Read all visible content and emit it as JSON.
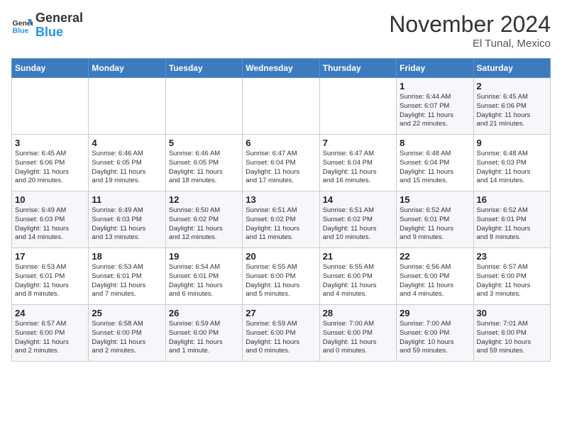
{
  "header": {
    "logo_general": "General",
    "logo_blue": "Blue",
    "month": "November 2024",
    "location": "El Tunal, Mexico"
  },
  "weekdays": [
    "Sunday",
    "Monday",
    "Tuesday",
    "Wednesday",
    "Thursday",
    "Friday",
    "Saturday"
  ],
  "weeks": [
    [
      {
        "day": "",
        "info": ""
      },
      {
        "day": "",
        "info": ""
      },
      {
        "day": "",
        "info": ""
      },
      {
        "day": "",
        "info": ""
      },
      {
        "day": "",
        "info": ""
      },
      {
        "day": "1",
        "info": "Sunrise: 6:44 AM\nSunset: 6:07 PM\nDaylight: 11 hours\nand 22 minutes."
      },
      {
        "day": "2",
        "info": "Sunrise: 6:45 AM\nSunset: 6:06 PM\nDaylight: 11 hours\nand 21 minutes."
      }
    ],
    [
      {
        "day": "3",
        "info": "Sunrise: 6:45 AM\nSunset: 6:06 PM\nDaylight: 11 hours\nand 20 minutes."
      },
      {
        "day": "4",
        "info": "Sunrise: 6:46 AM\nSunset: 6:05 PM\nDaylight: 11 hours\nand 19 minutes."
      },
      {
        "day": "5",
        "info": "Sunrise: 6:46 AM\nSunset: 6:05 PM\nDaylight: 11 hours\nand 18 minutes."
      },
      {
        "day": "6",
        "info": "Sunrise: 6:47 AM\nSunset: 6:04 PM\nDaylight: 11 hours\nand 17 minutes."
      },
      {
        "day": "7",
        "info": "Sunrise: 6:47 AM\nSunset: 6:04 PM\nDaylight: 11 hours\nand 16 minutes."
      },
      {
        "day": "8",
        "info": "Sunrise: 6:48 AM\nSunset: 6:04 PM\nDaylight: 11 hours\nand 15 minutes."
      },
      {
        "day": "9",
        "info": "Sunrise: 6:48 AM\nSunset: 6:03 PM\nDaylight: 11 hours\nand 14 minutes."
      }
    ],
    [
      {
        "day": "10",
        "info": "Sunrise: 6:49 AM\nSunset: 6:03 PM\nDaylight: 11 hours\nand 14 minutes."
      },
      {
        "day": "11",
        "info": "Sunrise: 6:49 AM\nSunset: 6:03 PM\nDaylight: 11 hours\nand 13 minutes."
      },
      {
        "day": "12",
        "info": "Sunrise: 6:50 AM\nSunset: 6:02 PM\nDaylight: 11 hours\nand 12 minutes."
      },
      {
        "day": "13",
        "info": "Sunrise: 6:51 AM\nSunset: 6:02 PM\nDaylight: 11 hours\nand 11 minutes."
      },
      {
        "day": "14",
        "info": "Sunrise: 6:51 AM\nSunset: 6:02 PM\nDaylight: 11 hours\nand 10 minutes."
      },
      {
        "day": "15",
        "info": "Sunrise: 6:52 AM\nSunset: 6:01 PM\nDaylight: 11 hours\nand 9 minutes."
      },
      {
        "day": "16",
        "info": "Sunrise: 6:52 AM\nSunset: 6:01 PM\nDaylight: 11 hours\nand 8 minutes."
      }
    ],
    [
      {
        "day": "17",
        "info": "Sunrise: 6:53 AM\nSunset: 6:01 PM\nDaylight: 11 hours\nand 8 minutes."
      },
      {
        "day": "18",
        "info": "Sunrise: 6:53 AM\nSunset: 6:01 PM\nDaylight: 11 hours\nand 7 minutes."
      },
      {
        "day": "19",
        "info": "Sunrise: 6:54 AM\nSunset: 6:01 PM\nDaylight: 11 hours\nand 6 minutes."
      },
      {
        "day": "20",
        "info": "Sunrise: 6:55 AM\nSunset: 6:00 PM\nDaylight: 11 hours\nand 5 minutes."
      },
      {
        "day": "21",
        "info": "Sunrise: 6:55 AM\nSunset: 6:00 PM\nDaylight: 11 hours\nand 4 minutes."
      },
      {
        "day": "22",
        "info": "Sunrise: 6:56 AM\nSunset: 6:00 PM\nDaylight: 11 hours\nand 4 minutes."
      },
      {
        "day": "23",
        "info": "Sunrise: 6:57 AM\nSunset: 6:00 PM\nDaylight: 11 hours\nand 3 minutes."
      }
    ],
    [
      {
        "day": "24",
        "info": "Sunrise: 6:57 AM\nSunset: 6:00 PM\nDaylight: 11 hours\nand 2 minutes."
      },
      {
        "day": "25",
        "info": "Sunrise: 6:58 AM\nSunset: 6:00 PM\nDaylight: 11 hours\nand 2 minutes."
      },
      {
        "day": "26",
        "info": "Sunrise: 6:59 AM\nSunset: 6:00 PM\nDaylight: 11 hours\nand 1 minute."
      },
      {
        "day": "27",
        "info": "Sunrise: 6:59 AM\nSunset: 6:00 PM\nDaylight: 11 hours\nand 0 minutes."
      },
      {
        "day": "28",
        "info": "Sunrise: 7:00 AM\nSunset: 6:00 PM\nDaylight: 11 hours\nand 0 minutes."
      },
      {
        "day": "29",
        "info": "Sunrise: 7:00 AM\nSunset: 6:00 PM\nDaylight: 10 hours\nand 59 minutes."
      },
      {
        "day": "30",
        "info": "Sunrise: 7:01 AM\nSunset: 6:00 PM\nDaylight: 10 hours\nand 59 minutes."
      }
    ]
  ]
}
